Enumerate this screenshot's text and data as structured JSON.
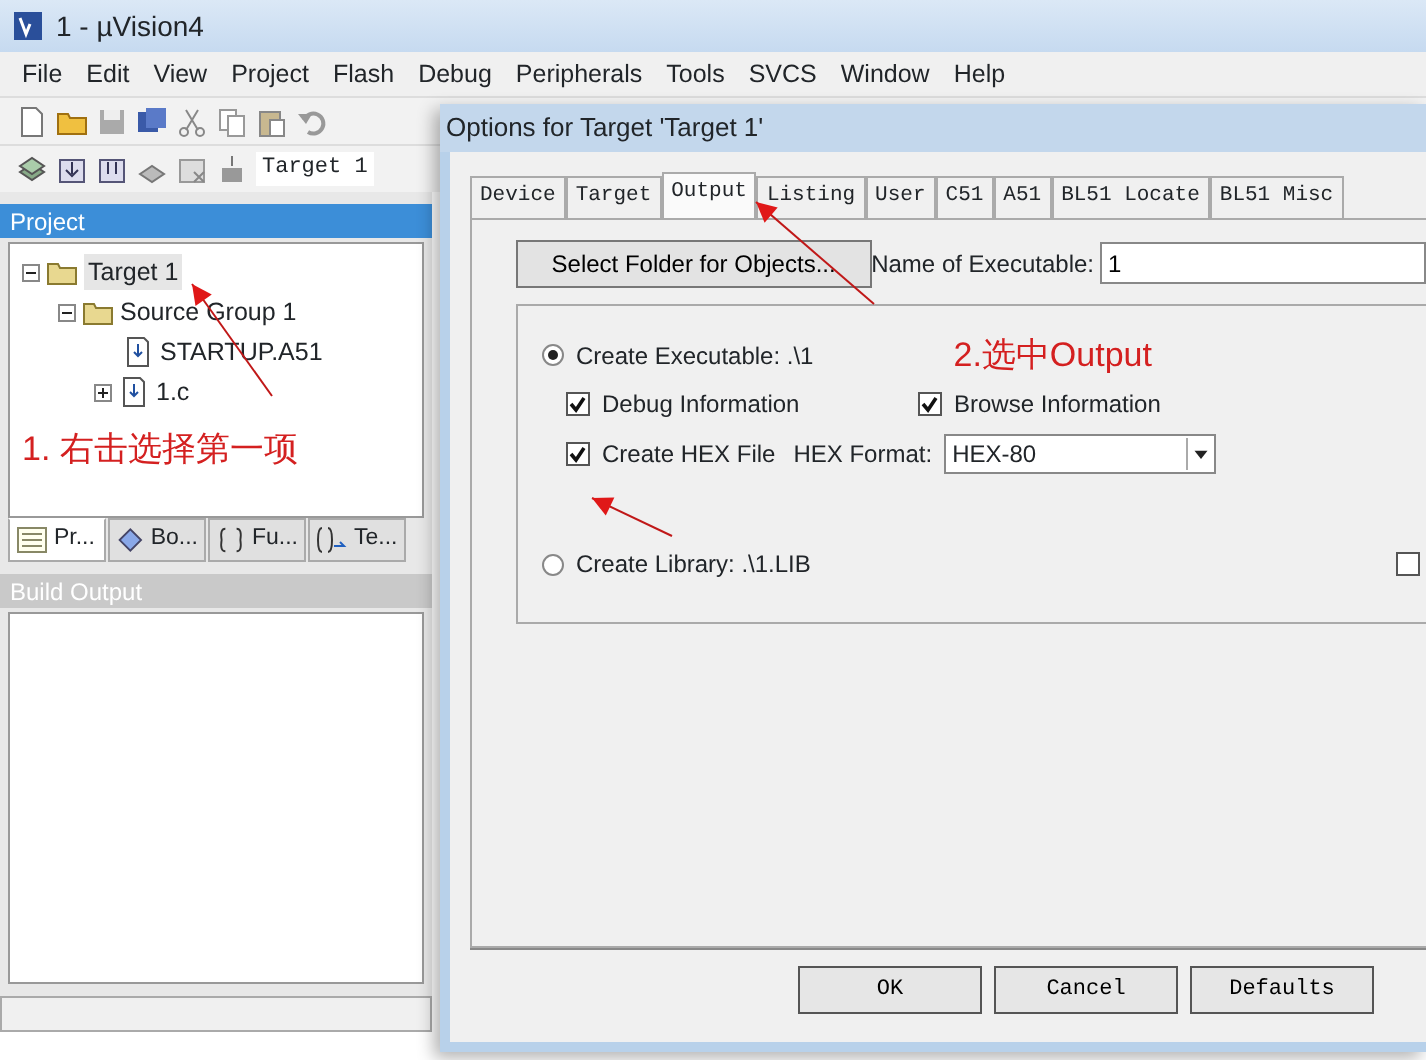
{
  "window": {
    "title": "1 - µVision4"
  },
  "menu": [
    "File",
    "Edit",
    "View",
    "Project",
    "Flash",
    "Debug",
    "Peripherals",
    "Tools",
    "SVCS",
    "Window",
    "Help"
  ],
  "toolbar": {
    "target_select": "Target 1"
  },
  "project_panel": {
    "title": "Project",
    "tree": [
      {
        "label": "Target 1",
        "selected": true,
        "expanded": true,
        "children": [
          {
            "label": "Source Group 1",
            "selected": false,
            "expanded": true,
            "children": [
              {
                "label": "STARTUP.A51",
                "selected": false
              },
              {
                "label": "1.c",
                "selected": false,
                "expanded": false
              }
            ]
          }
        ]
      }
    ],
    "annotation": "1. 右击选择第一项",
    "tabs": [
      {
        "label": "Pr...",
        "selected": true
      },
      {
        "label": "Bo...",
        "selected": false
      },
      {
        "label": "Fu...",
        "selected": false
      },
      {
        "label": "Te...",
        "selected": false
      }
    ]
  },
  "build_output": {
    "title": "Build Output"
  },
  "dialog": {
    "title": "Options for Target 'Target 1'",
    "tabs": [
      {
        "label": "Device",
        "selected": false
      },
      {
        "label": "Target",
        "selected": false
      },
      {
        "label": "Output",
        "selected": true
      },
      {
        "label": "Listing",
        "selected": false
      },
      {
        "label": "User",
        "selected": false
      },
      {
        "label": "C51",
        "selected": false
      },
      {
        "label": "A51",
        "selected": false
      },
      {
        "label": "BL51 Locate",
        "selected": false
      },
      {
        "label": "BL51 Misc",
        "selected": false
      }
    ],
    "select_folder_button": "Select Folder for Objects...",
    "executable_name": {
      "label": "Name of Executable:",
      "value": "1"
    },
    "create_executable": {
      "label": "Create Executable:  .\\1",
      "selected": true
    },
    "annotation": "2.选中Output",
    "debug_information": {
      "label": "Debug Information",
      "checked": true
    },
    "browse_information": {
      "label": "Browse Information",
      "checked": true
    },
    "create_hex_file": {
      "label": "Create HEX File",
      "checked": true
    },
    "hex_format": {
      "label": "HEX Format:",
      "value": "HEX-80"
    },
    "create_library": {
      "label": "Create Library:  .\\1.LIB",
      "selected": false
    },
    "side_checkbox": {
      "checked": false
    },
    "buttons": [
      "OK",
      "Cancel",
      "Defaults"
    ]
  }
}
